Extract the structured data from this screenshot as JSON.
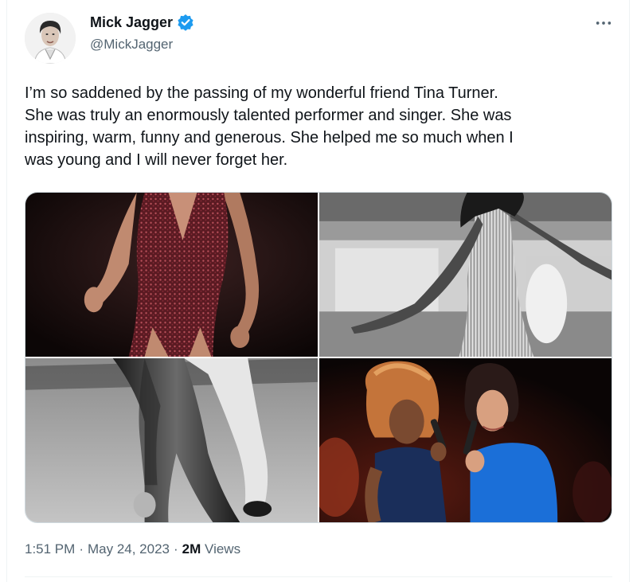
{
  "author": {
    "name": "Mick Jagger",
    "handle": "@MickJagger",
    "verified": true
  },
  "tweet": {
    "lines": [
      "I’m so saddened by the passing of my wonderful friend Tina Turner.",
      "She was truly an enormously talented performer and singer. She was",
      "inspiring, warm, funny and generous. She helped me so much when I",
      "was young and I will never forget her."
    ]
  },
  "media": [
    {
      "description": "tina-performing-red-dress-photo"
    },
    {
      "description": "tina-on-stage-fringe-dress-bw-photo"
    },
    {
      "description": "legs-leather-trousers-bw-photo"
    },
    {
      "description": "tina-and-mick-singing-photo"
    }
  ],
  "meta": {
    "time": "1:51 PM",
    "separator": "·",
    "date": "May 24, 2023",
    "views_count": "2M",
    "views_label": "Views"
  },
  "colors": {
    "verified_badge": "#1d9bf0",
    "secondary_text": "#536471",
    "primary_text": "#0f1419"
  },
  "icons": {
    "more": "more-dots-icon",
    "verified": "verified-badge-icon"
  }
}
